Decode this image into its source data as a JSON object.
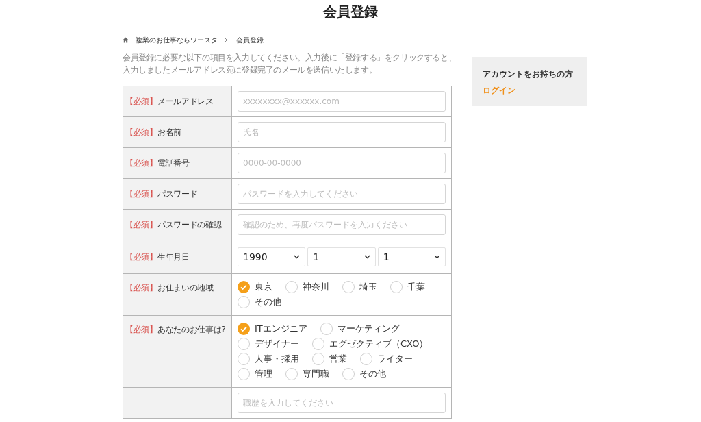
{
  "page_title": "会員登録",
  "breadcrumb": [
    {
      "label": "複業のお仕事ならワースタ",
      "kind": "link"
    },
    {
      "label": "会員登録",
      "kind": "current"
    }
  ],
  "intro": "会員登録に必要な以下の項目を入力してください。入力後に「登録する」をクリックすると、入力しましたメールアドレス宛に登録完了のメールを送信いたします。",
  "form": {
    "rows": [
      {
        "kind": "text",
        "required_tag": "【必須】",
        "label": "メールアドレス",
        "placeholder": "xxxxxxxx@xxxxxx.com"
      },
      {
        "kind": "text",
        "required_tag": "【必須】",
        "label": "お名前",
        "placeholder": "氏名"
      },
      {
        "kind": "text",
        "required_tag": "【必須】",
        "label": "電話番号",
        "placeholder": "0000-00-0000"
      },
      {
        "kind": "text",
        "required_tag": "【必須】",
        "label": "パスワード",
        "placeholder": "パスワードを入力してください"
      },
      {
        "kind": "text",
        "required_tag": "【必須】",
        "label": "パスワードの確認",
        "placeholder": "確認のため、再度パスワードを入力ください"
      },
      {
        "kind": "select",
        "required_tag": "【必須】",
        "label": "生年月日",
        "selects": [
          {
            "value": "1990"
          },
          {
            "value": "1"
          },
          {
            "value": "1"
          }
        ]
      },
      {
        "kind": "radio",
        "required_tag": "【必須】",
        "label": "お住まいの地域",
        "options": [
          {
            "label": "東京",
            "selected": true
          },
          {
            "label": "神奈川",
            "selected": false
          },
          {
            "label": "埼玉",
            "selected": false
          },
          {
            "label": "千葉",
            "selected": false
          },
          {
            "label": "その他",
            "selected": false
          }
        ]
      },
      {
        "kind": "radio",
        "required_tag": "【必須】",
        "label": "あなたのお仕事は?",
        "options": [
          {
            "label": "ITエンジニア",
            "selected": true
          },
          {
            "label": "マーケティング",
            "selected": false
          },
          {
            "label": "デザイナー",
            "selected": false
          },
          {
            "label": "エグゼクティブ（CXO）",
            "selected": false
          },
          {
            "label": "人事・採用",
            "selected": false
          },
          {
            "label": "営業",
            "selected": false
          },
          {
            "label": "ライター",
            "selected": false
          },
          {
            "label": "管理",
            "selected": false
          },
          {
            "label": "専門職",
            "selected": false
          },
          {
            "label": "その他",
            "selected": false
          }
        ]
      },
      {
        "kind": "text",
        "placeholder": "職歴を入力してください"
      }
    ]
  },
  "sidebar": {
    "heading": "アカウントをお持ちの方",
    "link": "ログイン"
  }
}
